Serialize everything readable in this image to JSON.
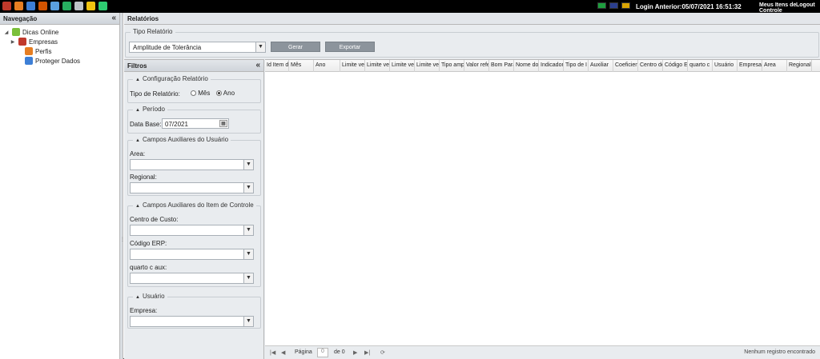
{
  "topbar": {
    "icons": [
      {
        "name": "rocket-icon",
        "color": "#c0392b"
      },
      {
        "name": "user-tools-icon",
        "color": "#e67e22"
      },
      {
        "name": "calendar-icon",
        "color": "#3d7fd6"
      },
      {
        "name": "runner-icon",
        "color": "#d35400"
      },
      {
        "name": "document-icon",
        "color": "#5aa0e0"
      },
      {
        "name": "chart-icon",
        "color": "#27ae60"
      },
      {
        "name": "printer-icon",
        "color": "#bdc3c7"
      },
      {
        "name": "emoticon-icon",
        "color": "#f1c40f"
      },
      {
        "name": "refresh-icon",
        "color": "#2ecc71"
      }
    ],
    "flags": [
      {
        "name": "brazil-flag-icon",
        "color": "#1e9e3e"
      },
      {
        "name": "uk-flag-icon",
        "color": "#2b3f8f"
      },
      {
        "name": "spain-flag-icon",
        "color": "#d9a404"
      }
    ],
    "login": "Login Anterior:05/07/2021 16:51:32",
    "meus_itens": "Meus Itens de Controle",
    "logout": "Logout"
  },
  "nav": {
    "title": "Navegação",
    "collapse_glyph": "«",
    "items": [
      {
        "label": "Dicas Online",
        "arrow": "◢",
        "icon_color": "#7bbf3a",
        "name": "dicas-online"
      },
      {
        "label": "Empresas",
        "arrow": "▶",
        "icon_color": "#c0392b",
        "name": "empresas"
      },
      {
        "label": "Perfis",
        "arrow": "",
        "icon_color": "#e67e22",
        "name": "perfis"
      },
      {
        "label": "Proteger Dados",
        "arrow": "",
        "icon_color": "#3d7fd6",
        "name": "proteger-dados"
      }
    ]
  },
  "main": {
    "title": "Relatórios",
    "tipo_relatorio": {
      "legend": "Tipo Relatório",
      "value": "Amplitude de Tolerância",
      "gerar": "Gerar",
      "exportar": "Exportar"
    }
  },
  "filtros": {
    "title": "Filtros",
    "collapse_glyph": "«",
    "config": {
      "legend": "Configuração Relatório",
      "tipo_label": "Tipo de Relatório:",
      "opt_mes": "Mês",
      "opt_ano": "Ano"
    },
    "periodo": {
      "legend": "Período",
      "data_base_label": "Data Base:",
      "data_base_value": "07/2021"
    },
    "campos_usuario": {
      "legend": "Campos Auxiliares do Usuário",
      "area": "Area:",
      "regional": "Regional:"
    },
    "campos_item": {
      "legend": "Campos Auxiliares do Item de Controle",
      "centro_custo": "Centro de Custo:",
      "codigo_erp": "Código ERP:",
      "quarto_c_aux": "quarto c aux:"
    },
    "usuario": {
      "legend": "Usuário",
      "empresa": "Empresa:"
    }
  },
  "grid": {
    "columns": [
      "Id Item d",
      "Mês",
      "Ano",
      "Limite ve",
      "Limite ve",
      "Limite ve",
      "Limite ve",
      "Tipo amp",
      "Valor refe",
      "Bom Para",
      "Nome do",
      "Indicador",
      "Tipo de I",
      "Auxiliar",
      "Coeficien",
      "Centro de",
      "Código E",
      "quarto c",
      "Usuário",
      "Empresa",
      "Area",
      "Regional"
    ],
    "pager": {
      "pagina": "Página",
      "page_value": "0",
      "de": "de 0",
      "status": "Nenhum registro encontrado"
    }
  }
}
